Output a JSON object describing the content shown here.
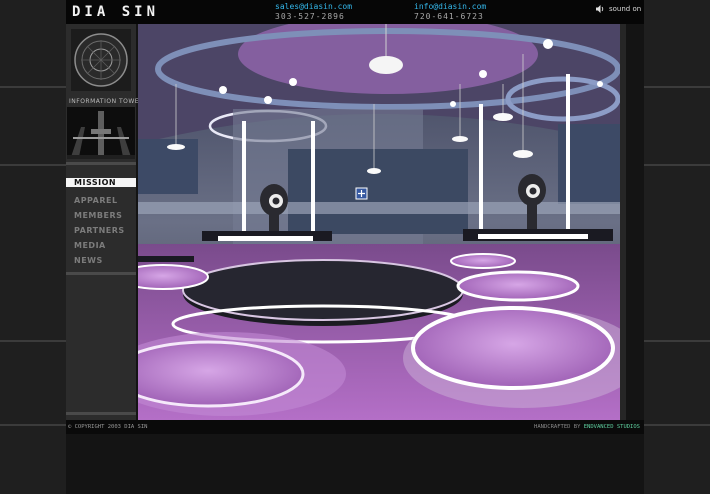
{
  "header": {
    "logo": "DIA SIN",
    "sales": {
      "email": "sales@diasin.com",
      "phone": "303-527-2896"
    },
    "info": {
      "email": "info@diasin.com",
      "phone": "720-641-6723"
    },
    "sound_label": "sound on"
  },
  "sidebar": {
    "tower_label": "INFORMATION TOWER",
    "nav": [
      {
        "label": "MISSION",
        "active": true
      },
      {
        "label": "APPAREL"
      },
      {
        "label": "MEMBERS"
      },
      {
        "label": "PARTNERS"
      },
      {
        "label": "MEDIA"
      },
      {
        "label": "NEWS"
      }
    ]
  },
  "footer": {
    "copyright": "© COPYRIGHT 2003 DIA SIN",
    "credit_prefix": "HANDCRAFTED BY",
    "credit_studio": "ENDVANCED STUDIOS"
  },
  "colors": {
    "email": "#34b7ea",
    "accent_purple": "#b25fd0",
    "studio": "#5fd0a0"
  }
}
